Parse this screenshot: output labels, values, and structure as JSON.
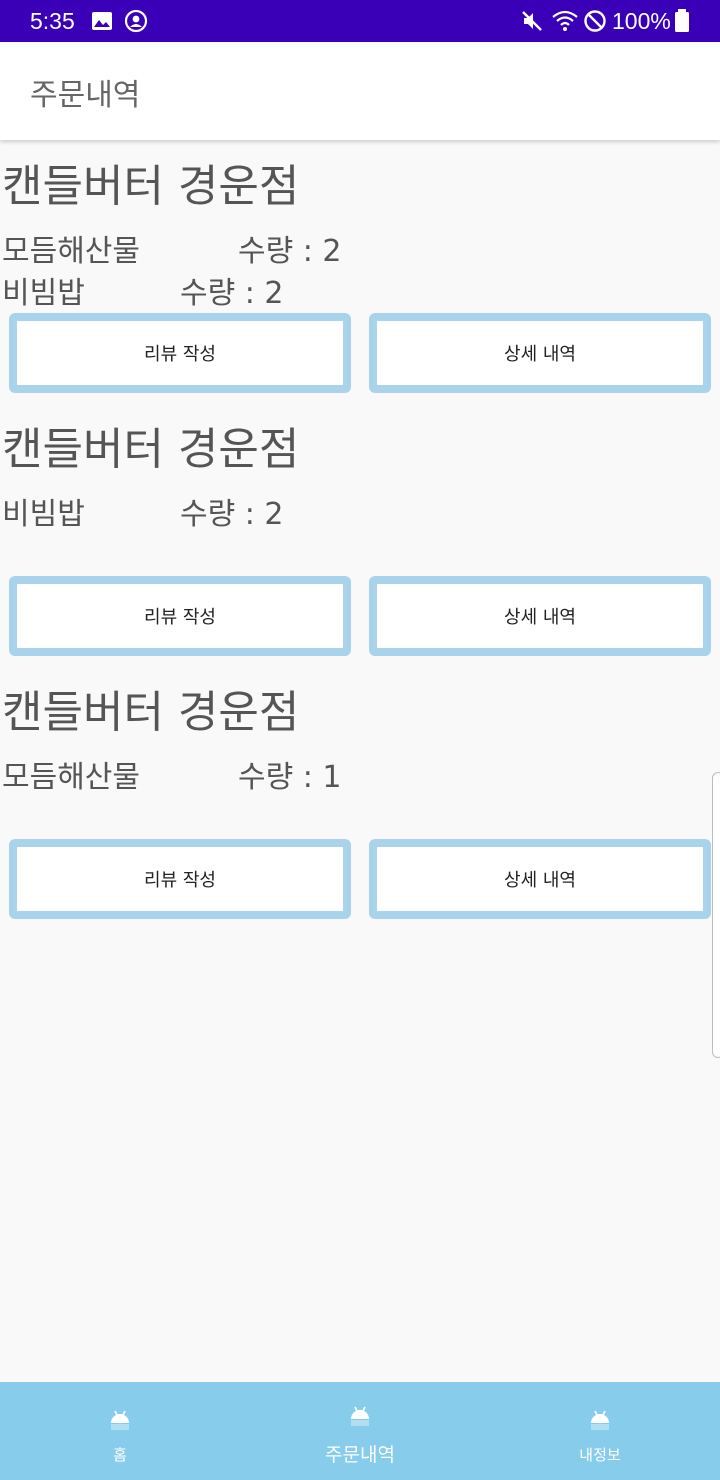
{
  "status_bar": {
    "time": "5:35",
    "battery_text": "100%",
    "icons": [
      "image-icon",
      "account-circle-icon",
      "mute-icon",
      "wifi-icon",
      "do-not-disturb-icon",
      "battery-icon"
    ]
  },
  "app_bar": {
    "title": "주문내역"
  },
  "orders": [
    {
      "store": "캔들버터 경운점",
      "items": [
        {
          "name": "모듬해산물",
          "qty": "수량 : 2"
        },
        {
          "name": "비빔밥",
          "qty": "수량 : 2"
        }
      ],
      "review_label": "리뷰 작성",
      "detail_label": "상세 내역"
    },
    {
      "store": "캔들버터 경운점",
      "items": [
        {
          "name": "비빔밥",
          "qty": "수량 : 2"
        }
      ],
      "review_label": "리뷰 작성",
      "detail_label": "상세 내역"
    },
    {
      "store": "캔들버터 경운점",
      "items": [
        {
          "name": "모듬해산물",
          "qty": "수량 : 1"
        }
      ],
      "review_label": "리뷰 작성",
      "detail_label": "상세 내역"
    }
  ],
  "bottom_nav": [
    {
      "label": "홈",
      "icon": "android-icon",
      "selected": false
    },
    {
      "label": "주문내역",
      "icon": "android-icon",
      "selected": true
    },
    {
      "label": "내정보",
      "icon": "android-icon",
      "selected": false
    }
  ],
  "colors": {
    "status_bar": "#3a00b8",
    "button_border": "#a9d3ea",
    "bottom_nav": "#87cceb",
    "text": "#555555"
  }
}
